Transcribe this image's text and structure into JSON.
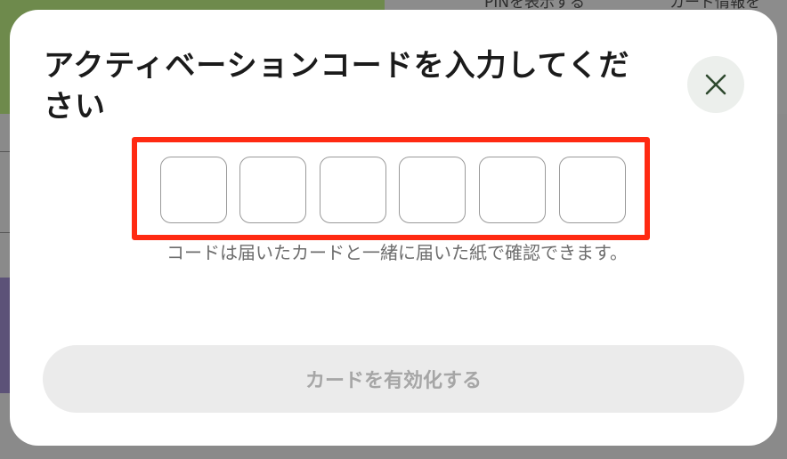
{
  "background": {
    "links": [
      "PINを表示する",
      "カード情報を"
    ]
  },
  "modal": {
    "title": "アクティベーションコードを入力してください",
    "close_icon": "close-icon",
    "code_digits": [
      "",
      "",
      "",
      "",
      "",
      ""
    ],
    "hint": "コードは届いたカードと一緒に届いた紙で確認できます。",
    "activate_label": "カードを有効化する"
  },
  "colors": {
    "highlight_frame": "#ff2a12",
    "close_icon": "#2f4a2f",
    "button_disabled_bg": "#ebebeb",
    "button_disabled_text": "#a6a6a6"
  }
}
